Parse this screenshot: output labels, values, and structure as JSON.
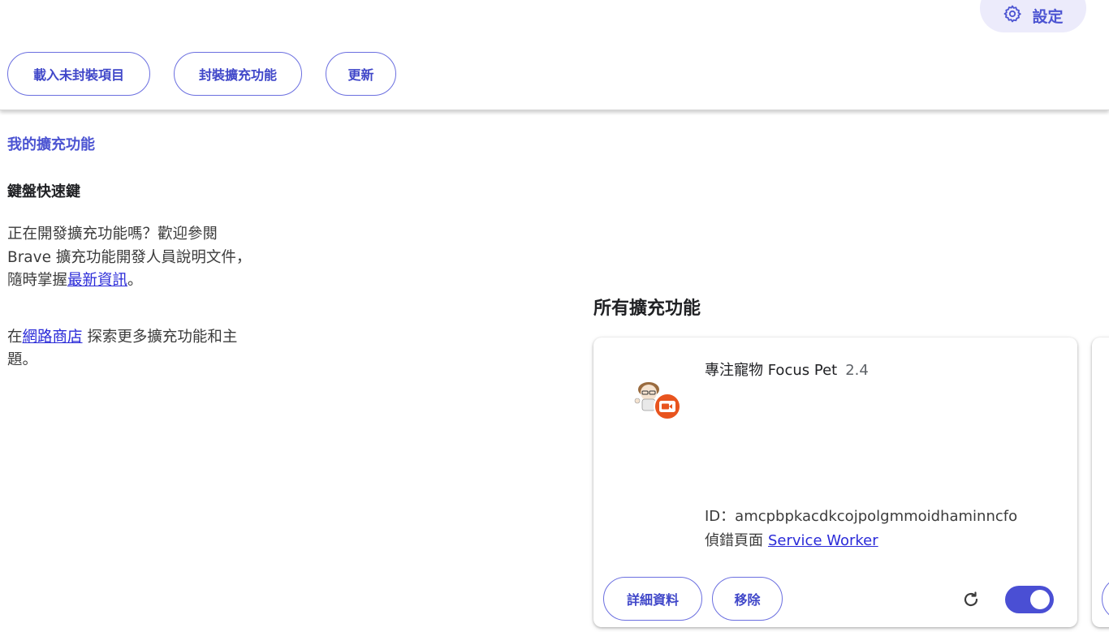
{
  "header": {
    "settings_label": "設定",
    "buttons": {
      "load_unpacked": "載入未封裝項目",
      "pack_extension": "封裝擴充功能",
      "update": "更新"
    }
  },
  "sidebar": {
    "my_extensions": "我的擴充功能",
    "keyboard_shortcuts": "鍵盤快速鍵",
    "dev_text_prefix": "正在開發擴充功能嗎？歡迎參閱 Brave 擴充功能開發人員說明文件，隨時掌握",
    "dev_link": "最新資訊",
    "dev_text_suffix": "。",
    "store_prefix": "在",
    "store_link": "網路商店",
    "store_suffix": " 探索更多擴充功能和主題。"
  },
  "main": {
    "section_title": "所有擴充功能",
    "extension": {
      "name": "專注寵物 Focus Pet",
      "version": "2.4",
      "id_line": "ID：amcpbpkacdkcojpolgmmoidhaminncfo",
      "inspect_label": "偵錯頁面",
      "inspect_link": "Service Worker",
      "details_button": "詳細資料",
      "remove_button": "移除",
      "enabled": true
    }
  },
  "icons": {
    "settings": "gear-icon",
    "reload": "reload-icon",
    "badge": "record-badge-icon"
  },
  "colors": {
    "accent": "#4c54d2",
    "link": "#2a2ad8",
    "badge": "#e8541e"
  }
}
